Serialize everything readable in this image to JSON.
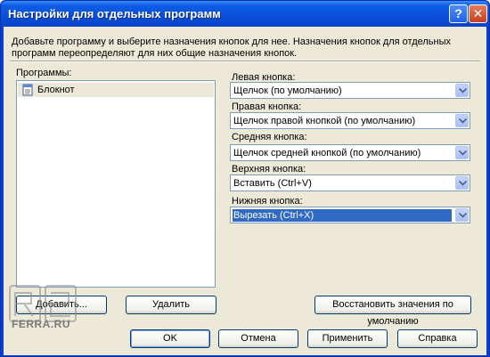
{
  "window": {
    "title": "Настройки для отдельных программ",
    "help_label": "?",
    "close_label": "✕"
  },
  "description": "Добавьте программу и выберите назначения кнопок для нее. Назначения кнопок для отдельных программ переопределяют для них общие назначения кнопок.",
  "programs": {
    "label": "Программы:",
    "items": [
      {
        "label": "Блокнот",
        "icon": "notepad-icon",
        "selected": true
      }
    ],
    "add_label": "Добавить...",
    "remove_label": "Удалить"
  },
  "buttons_config": {
    "left": {
      "label": "Левая кнопка:",
      "value": "Щелчок (по умолчанию)"
    },
    "right": {
      "label": "Правая кнопка:",
      "value": "Щелчок правой кнопкой (по умолчанию)"
    },
    "middle": {
      "label": "Средняя кнопка:",
      "value": "Щелчок средней кнопкой (по умолчанию)"
    },
    "upper": {
      "label": "Верхняя кнопка:",
      "value": "Вставить (Ctrl+V)"
    },
    "lower": {
      "label": "Нижняя кнопка:",
      "value": "Вырезать (Ctrl+X)",
      "focused": true
    },
    "restore_label": "Восстановить значения по умолчанию"
  },
  "footer": {
    "ok_label": "OK",
    "cancel_label": "Отмена",
    "apply_label": "Применить",
    "help_label": "Справка"
  },
  "watermark": {
    "text": "FERRA.RU",
    "logo": "r2"
  },
  "colors": {
    "titlebar": "#0a4ed8",
    "dialog_bg": "#ece9d8",
    "selection": "#316ac5",
    "border": "#7f9db9"
  }
}
